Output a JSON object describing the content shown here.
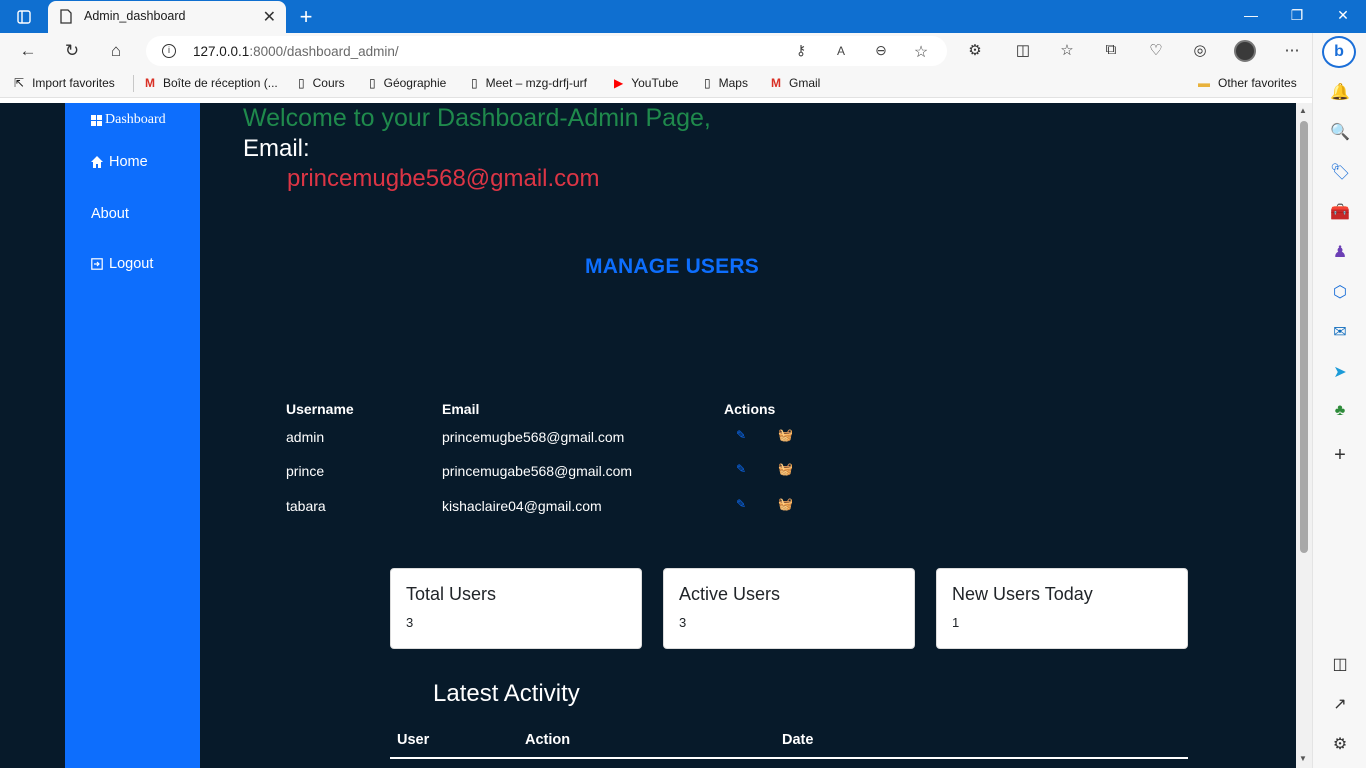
{
  "browser": {
    "tab_title": "Admin_dashboard",
    "url_host": "127.0.0.1",
    "url_rest": ":8000/dashboard_admin/",
    "bookmarks": [
      {
        "label": "Import favorites",
        "icon": "import-icon"
      },
      {
        "label": "Boîte de réception (...",
        "icon": "gmail-icon"
      },
      {
        "label": "Cours",
        "icon": "page-icon"
      },
      {
        "label": "Géographie",
        "icon": "page-icon"
      },
      {
        "label": "Meet – mzg-drfj-urf",
        "icon": "page-icon"
      },
      {
        "label": "YouTube",
        "icon": "youtube-icon"
      },
      {
        "label": "Maps",
        "icon": "page-icon"
      },
      {
        "label": "Gmail",
        "icon": "gmail-icon"
      }
    ],
    "other_favorites": "Other favorites"
  },
  "sidebar": {
    "brand": "Dashboard",
    "items": [
      {
        "label": "Home",
        "icon": "home-icon"
      },
      {
        "label": "About",
        "icon": ""
      },
      {
        "label": "Logout",
        "icon": "logout-icon"
      }
    ]
  },
  "header": {
    "welcome": "Welcome to your Dashboard-Admin Page,",
    "email_label": "Email:",
    "email_value": "princemugbe568@gmail.com"
  },
  "manage_users": {
    "title": "MANAGE USERS",
    "columns": [
      "Username",
      "Email",
      "Actions"
    ],
    "rows": [
      {
        "username": "admin",
        "email": "princemugbe568@gmail.com"
      },
      {
        "username": "prince",
        "email": "princemugabe568@gmail.com"
      },
      {
        "username": "tabara",
        "email": "kishaclaire04@gmail.com"
      }
    ]
  },
  "stats": [
    {
      "title": "Total Users",
      "value": "3"
    },
    {
      "title": "Active Users",
      "value": "3"
    },
    {
      "title": "New Users Today",
      "value": "1"
    }
  ],
  "latest_activity": {
    "title": "Latest Activity",
    "columns": [
      "User",
      "Action",
      "Date"
    ]
  },
  "colors": {
    "page_bg": "#071a2a",
    "sidebar_bg": "#0d6efd",
    "welcome": "#1f8a4c",
    "email": "#dc3545",
    "accent": "#0d6efd"
  }
}
